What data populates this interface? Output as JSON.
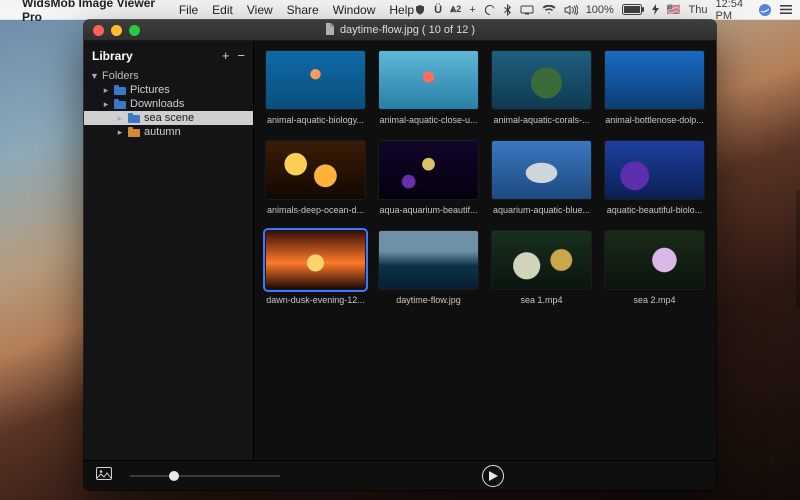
{
  "menubar": {
    "app_name": "WidsMob Image Viewer Pro",
    "items": [
      "File",
      "Edit",
      "View",
      "Share",
      "Window",
      "Help"
    ],
    "status": {
      "battery": "100%",
      "day": "Thu",
      "time": "12:54 PM",
      "flag": "🇺🇸",
      "aa_badge": "2"
    }
  },
  "window": {
    "title": "daytime-flow.jpg  ( 10 of 12 )",
    "sidebar": {
      "heading": "Library",
      "add_label": "+",
      "remove_label": "−",
      "root": {
        "label": "Folders"
      },
      "folders": [
        {
          "label": "Pictures",
          "selected": false,
          "color": "blue"
        },
        {
          "label": "Downloads",
          "selected": false,
          "color": "blue"
        },
        {
          "label": "sea scene",
          "selected": true,
          "color": "blue"
        },
        {
          "label": "autumn",
          "selected": false,
          "color": "orange"
        }
      ]
    },
    "grid": [
      {
        "caption": "animal-aquatic-biology...",
        "style": "sea-blue",
        "selected": false
      },
      {
        "caption": "animal-aquatic-close-u...",
        "style": "sea-cyan",
        "selected": false
      },
      {
        "caption": "animal-aquatic-corals-...",
        "style": "turtle",
        "selected": false
      },
      {
        "caption": "animal-bottlenose-dolp...",
        "style": "dolphin",
        "selected": false
      },
      {
        "caption": "animals-deep-ocean-d...",
        "style": "jelly-gold",
        "selected": false
      },
      {
        "caption": "aqua-aquarium-beautif...",
        "style": "jelly-purple",
        "selected": false
      },
      {
        "caption": "aquarium-aquatic-blue...",
        "style": "fish",
        "selected": false
      },
      {
        "caption": "aquatic-beautiful-biolo...",
        "style": "coral-blue",
        "selected": false
      },
      {
        "caption": "dawn-dusk-evening-12...",
        "style": "sunset",
        "selected": true
      },
      {
        "caption": "daytime-flow.jpg",
        "style": "wave",
        "selected": false
      },
      {
        "caption": "sea 1.mp4",
        "style": "reef1",
        "selected": false
      },
      {
        "caption": "sea 2.mp4",
        "style": "reef2",
        "selected": false
      }
    ],
    "footer": {
      "zoom_pct": 26
    }
  }
}
